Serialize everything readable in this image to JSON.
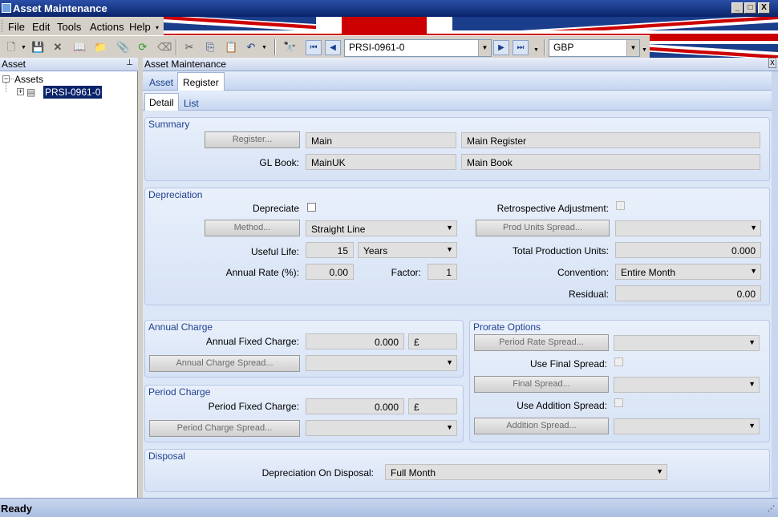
{
  "window": {
    "title": "Asset Maintenance",
    "min": "_",
    "max": "□",
    "close": "X"
  },
  "menu": [
    "File",
    "Edit",
    "Tools",
    "Actions",
    "Help"
  ],
  "toolbar": {
    "record": "PRSI-0961-0",
    "currency": "GBP"
  },
  "left": {
    "header": "Asset",
    "pin": "⊥",
    "root": "Assets",
    "node": "PRSI-0961-0"
  },
  "right": {
    "header": "Asset Maintenance",
    "close": "x"
  },
  "tabs": [
    "Asset",
    "Register"
  ],
  "subtabs": [
    "Detail",
    "List"
  ],
  "summary": {
    "title": "Summary",
    "register_btn": "Register...",
    "register_code": "Main",
    "register_name": "Main Register",
    "gl_label": "GL Book:",
    "gl_code": "MainUK",
    "gl_name": "Main Book"
  },
  "depreciation": {
    "title": "Depreciation",
    "depreciate_label": "Depreciate",
    "retro_label": "Retrospective Adjustment:",
    "method_btn": "Method...",
    "method_value": "Straight Line",
    "prod_btn": "Prod Units Spread...",
    "useful_label": "Useful Life:",
    "useful_value": "15",
    "useful_unit": "Years",
    "total_prod_label": "Total Production Units:",
    "total_prod_value": "0.000",
    "annual_rate_label": "Annual Rate (%):",
    "annual_rate_value": "0.00",
    "factor_label": "Factor:",
    "factor_value": "1",
    "convention_label": "Convention:",
    "convention_value": "Entire Month",
    "residual_label": "Residual:",
    "residual_value": "0.00"
  },
  "annual": {
    "title": "Annual Charge",
    "fixed_label": "Annual Fixed Charge:",
    "fixed_value": "0.000",
    "currency": "£",
    "spread_btn": "Annual Charge Spread..."
  },
  "period": {
    "title": "Period Charge",
    "fixed_label": "Period Fixed Charge:",
    "fixed_value": "0.000",
    "currency": "£",
    "spread_btn": "Period Charge Spread..."
  },
  "prorate": {
    "title": "Prorate Options",
    "rate_btn": "Period Rate Spread...",
    "final_label": "Use Final Spread:",
    "final_btn": "Final Spread...",
    "addition_label": "Use Addition Spread:",
    "addition_btn": "Addition Spread..."
  },
  "disposal": {
    "title": "Disposal",
    "label": "Depreciation On Disposal:",
    "value": "Full Month"
  },
  "status": "Ready",
  "colors": {
    "titlebar": "#0a246a",
    "group_title": "#1f3f8f",
    "panel": "#dbe6f7"
  }
}
